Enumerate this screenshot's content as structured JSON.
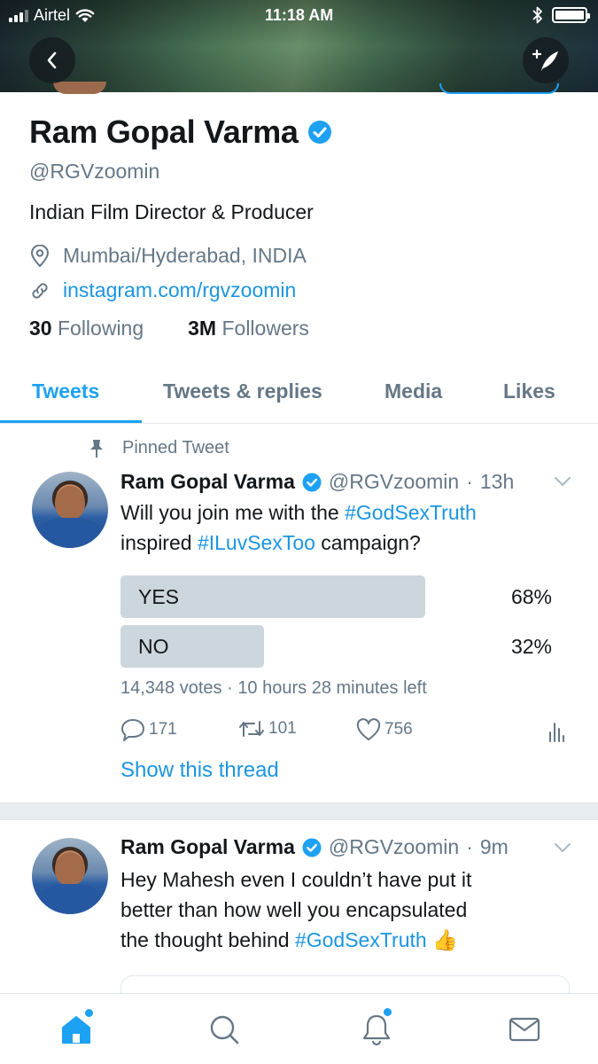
{
  "status_bar": {
    "carrier": "Airtel",
    "time": "11:18 AM"
  },
  "profile": {
    "name": "Ram Gopal Varma",
    "handle": "@RGVzoomin",
    "bio": "Indian Film Director & Producer",
    "location": "Mumbai/Hyderabad, INDIA",
    "website": "instagram.com/rgvzoomin",
    "following_count": "30",
    "following_label": "Following",
    "followers_count": "3M",
    "followers_label": "Followers"
  },
  "tabs": [
    {
      "label": "Tweets",
      "active": true
    },
    {
      "label": "Tweets & replies",
      "active": false
    },
    {
      "label": "Media",
      "active": false
    },
    {
      "label": "Likes",
      "active": false
    }
  ],
  "tweets": [
    {
      "pinned_label": "Pinned Tweet",
      "name": "Ram Gopal Varma",
      "handle": "@RGVzoomin",
      "time": "13h",
      "text_parts": {
        "p1": "Will you join me with the ",
        "tag1": "#GodSexTruth",
        "p2": "inspired  ",
        "tag2": "#ILuvSexToo",
        "p3": " campaign?"
      },
      "poll": {
        "options": [
          {
            "label": "YES",
            "percent_text": "68%",
            "percent": 68
          },
          {
            "label": "NO",
            "percent_text": "32%",
            "percent": 32
          }
        ],
        "votes_text": "14,348 votes",
        "time_left": "10 hours 28 minutes left"
      },
      "replies": "171",
      "retweets": "101",
      "likes": "756",
      "show_thread": "Show this thread"
    },
    {
      "name": "Ram Gopal Varma",
      "handle": "@RGVzoomin",
      "time": "9m",
      "text_parts": {
        "line1": "Hey Mahesh even I couldn’t have put it",
        "line2": "better than how well you encapsulated",
        "line3": "the thought behind ",
        "tag": "#GodSexTruth",
        "emoji": "👍"
      }
    }
  ],
  "colors": {
    "accent": "#1da1f2",
    "link": "#1b95e0",
    "muted": "#657786",
    "poll_bar": "#ccd6dd"
  }
}
